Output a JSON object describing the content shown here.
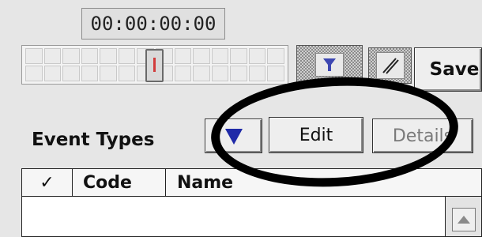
{
  "timecode": "00:00:00:00",
  "toolbar": {
    "filter_icon": "funnel-icon",
    "pencil_icon": "pencil-icon",
    "save_label": "Save"
  },
  "event_types": {
    "label": "Event Types",
    "arrow_icon": "triangle-down-icon",
    "edit_label": "Edit",
    "details_label": "Details"
  },
  "list": {
    "columns": [
      "✓",
      "Code",
      "Name"
    ]
  },
  "colors": {
    "annotation": "#000000",
    "arrow_blue": "#1f2aa8",
    "handle_red": "#d23c3c"
  }
}
